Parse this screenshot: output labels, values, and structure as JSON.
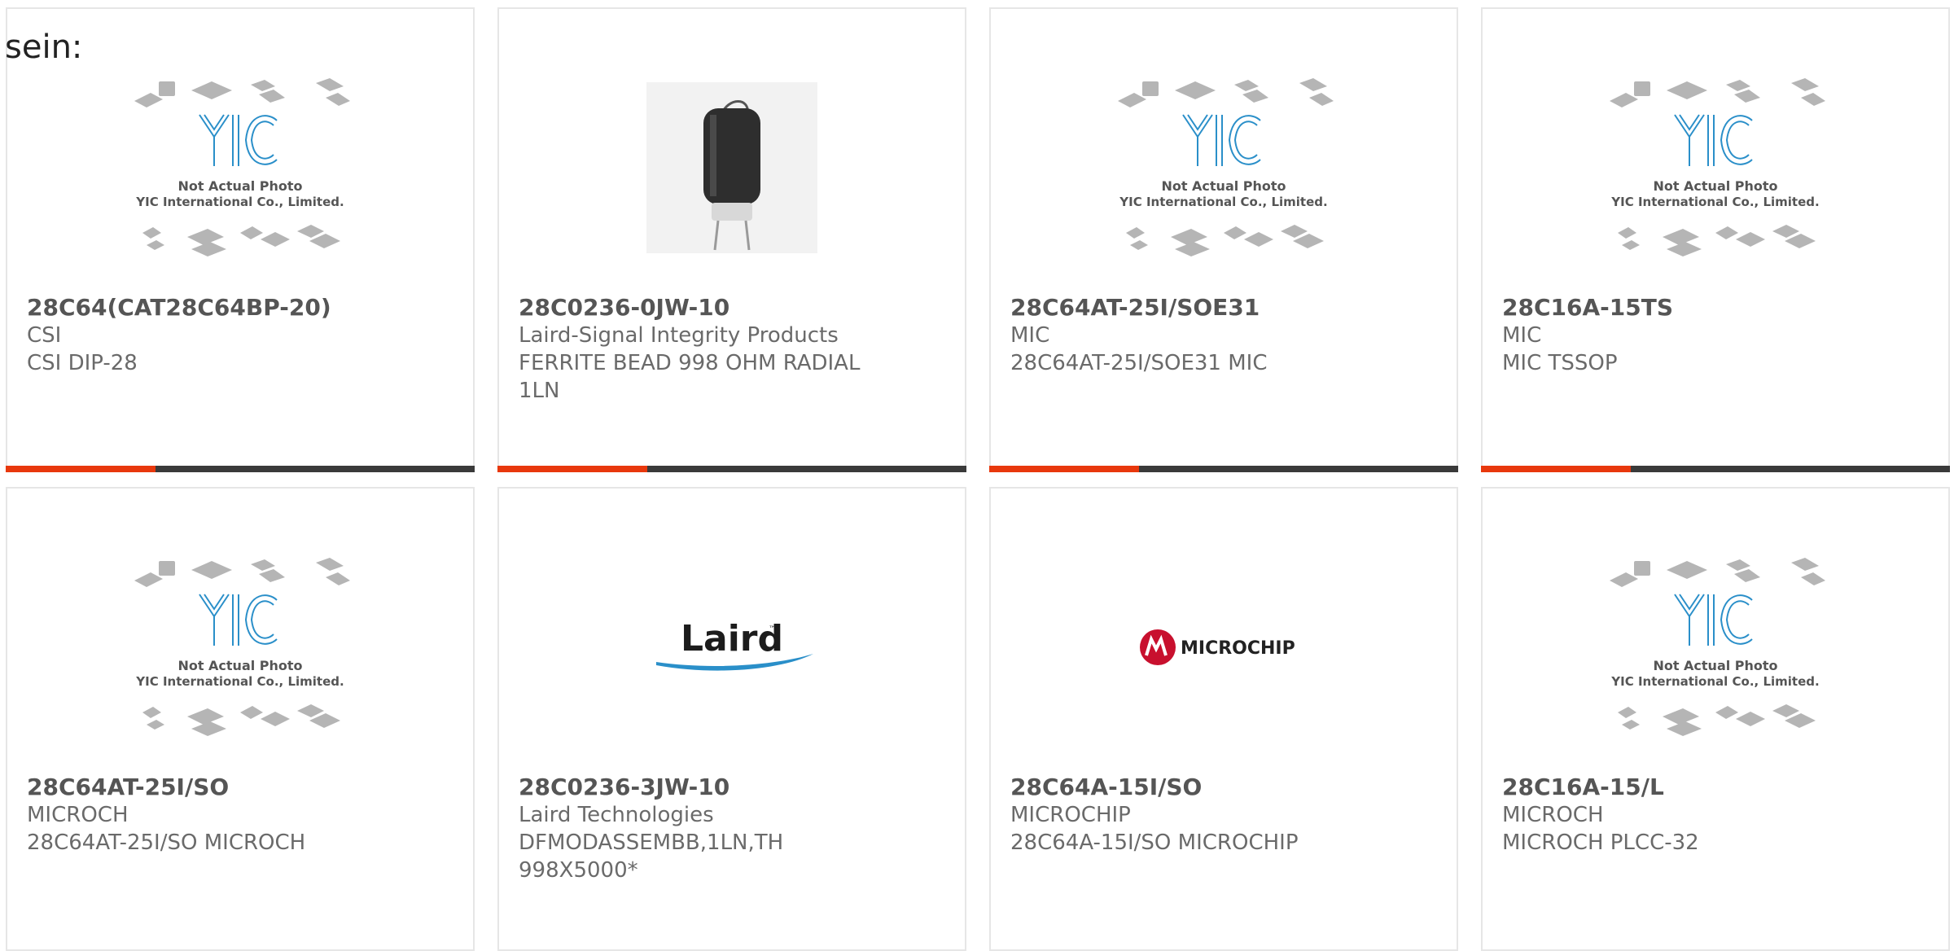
{
  "intro_text": "sein:",
  "colors": {
    "accent": "#e8380d",
    "bar": "#3a3a3a",
    "border": "#e6e6e6",
    "yic_blue": "#2a8fc9",
    "microchip_red": "#c8102e"
  },
  "placeholder": {
    "brand": "YIC",
    "line1": "Not Actual Photo",
    "line2": "YIC International Co., Limited."
  },
  "logos": {
    "laird": "Laird",
    "microchip": "MICROCHIP"
  },
  "products": [
    {
      "part_number": "28C64(CAT28C64BP-20)",
      "manufacturer": "CSI",
      "description": "CSI DIP-28",
      "image": "yic-placeholder"
    },
    {
      "part_number": "28C0236-0JW-10",
      "manufacturer": "Laird-Signal Integrity Products",
      "description": "FERRITE BEAD 998 OHM RADIAL 1LN",
      "image": "ferrite-bead-photo"
    },
    {
      "part_number": "28C64AT-25I/SOE31",
      "manufacturer": "MIC",
      "description": "28C64AT-25I/SOE31 MIC",
      "image": "yic-placeholder"
    },
    {
      "part_number": "28C16A-15TS",
      "manufacturer": "MIC",
      "description": "MIC TSSOP",
      "image": "yic-placeholder"
    },
    {
      "part_number": "28C64AT-25I/SO",
      "manufacturer": "MICROCH",
      "description": "28C64AT-25I/SO MICROCH",
      "image": "yic-placeholder"
    },
    {
      "part_number": "28C0236-3JW-10",
      "manufacturer": "Laird Technologies",
      "description": "DFMODASSEMBB,1LN,TH 998X5000*",
      "image": "laird-logo"
    },
    {
      "part_number": "28C64A-15I/SO",
      "manufacturer": "MICROCHIP",
      "description": "28C64A-15I/SO MICROCHIP",
      "image": "microchip-logo"
    },
    {
      "part_number": "28C16A-15/L",
      "manufacturer": "MICROCH",
      "description": "MICROCH PLCC-32",
      "image": "yic-placeholder"
    }
  ]
}
